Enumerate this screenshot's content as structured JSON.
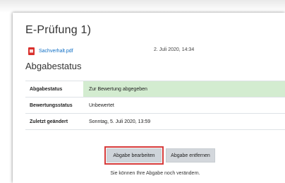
{
  "page": {
    "title": "E-Prüfung 1)"
  },
  "submission_file": {
    "icon": "pdf-file-icon",
    "name": "Sachverhalt.pdf",
    "date": "2. Juli 2020, 14:34",
    "link_color": "#0f6fc5"
  },
  "status_section": {
    "title": "Abgabestatus",
    "rows": [
      {
        "label": "Abgabestatus",
        "value": "Zur Bewertung abgegeben",
        "highlight": "#d3ecd0"
      },
      {
        "label": "Bewertungsstatus",
        "value": "Unbewertet"
      },
      {
        "label": "Zuletzt geändert",
        "value": "Sonntag, 5. Juli 2020, 13:59"
      }
    ]
  },
  "actions": {
    "edit_label": "Abgabe bearbeiten",
    "remove_label": "Abgabe entfernen",
    "hint": "Sie können Ihre Abgabe noch verändern.",
    "highlight_color": "#d63b3b"
  }
}
